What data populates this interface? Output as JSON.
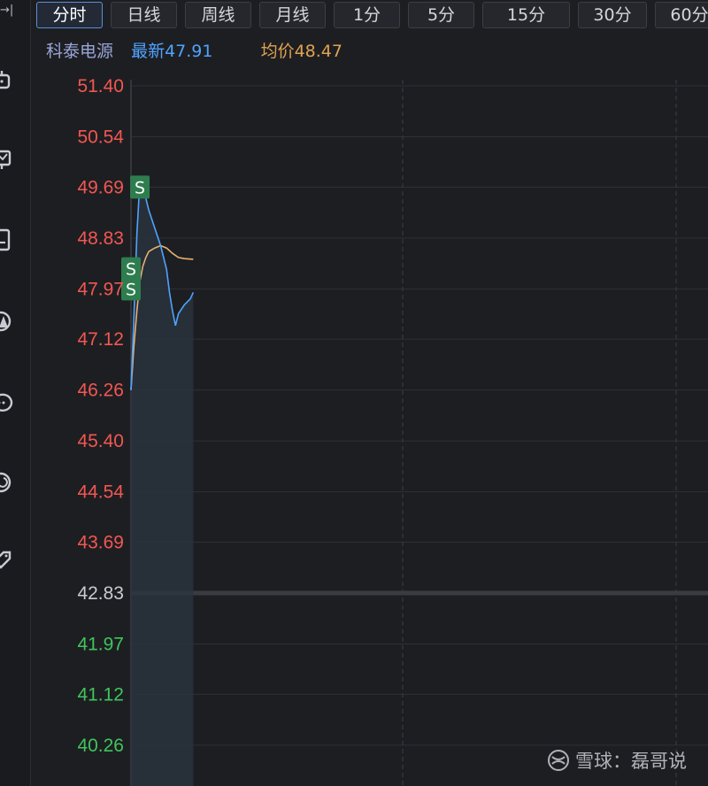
{
  "toolbar": {
    "expand_glyph": "→|",
    "tabs": [
      {
        "label": "分时",
        "active": true
      },
      {
        "label": "日线",
        "active": false
      },
      {
        "label": "周线",
        "active": false
      },
      {
        "label": "月线",
        "active": false
      },
      {
        "label": "1分",
        "active": false
      },
      {
        "label": "5分",
        "active": false
      },
      {
        "label": "15分",
        "active": false
      },
      {
        "label": "30分",
        "active": false
      },
      {
        "label": "60分",
        "active": false
      }
    ]
  },
  "legend": {
    "stock_name": "科泰电源",
    "latest_label": "最新",
    "latest_value": "47.91",
    "avg_label": "均价",
    "avg_value": "48.47"
  },
  "sidebar_icons": [
    "robot-icon",
    "monitor-chart-icon",
    "document-icon",
    "user-alert-icon",
    "chat-icon",
    "refresh-icon",
    "tag-icon"
  ],
  "colors": {
    "background": "#1d1e22",
    "up": "#f25751",
    "down": "#3fc55c",
    "neutral": "#c8cbd2",
    "price_line": "#4fa3ff",
    "avg_line": "#e8b070",
    "sell_marker": "#2e7d4f"
  },
  "chart_data": {
    "type": "line",
    "title": "",
    "ylim": [
      39.4,
      51.4
    ],
    "prev_close": 42.83,
    "yticks": [
      "51.40",
      "50.54",
      "49.69",
      "48.83",
      "47.97",
      "47.12",
      "46.26",
      "45.40",
      "44.54",
      "43.69",
      "42.83",
      "41.97",
      "41.12",
      "40.26"
    ],
    "x_range": [
      0,
      240
    ],
    "grid": true,
    "series": [
      {
        "name": "最新",
        "values": [
          [
            0,
            46.26
          ],
          [
            1,
            47.5
          ],
          [
            2,
            48.9
          ],
          [
            3,
            49.8
          ],
          [
            4,
            49.75
          ],
          [
            5,
            49.5
          ],
          [
            6,
            49.3
          ],
          [
            8,
            49.0
          ],
          [
            10,
            48.7
          ],
          [
            12,
            48.3
          ],
          [
            13,
            47.9
          ],
          [
            14,
            47.6
          ],
          [
            15,
            47.35
          ],
          [
            16,
            47.55
          ],
          [
            18,
            47.7
          ],
          [
            20,
            47.8
          ],
          [
            21,
            47.91
          ]
        ]
      },
      {
        "name": "均价",
        "values": [
          [
            0,
            46.26
          ],
          [
            1,
            47.0
          ],
          [
            2,
            47.6
          ],
          [
            3,
            48.1
          ],
          [
            4,
            48.35
          ],
          [
            5,
            48.5
          ],
          [
            6,
            48.6
          ],
          [
            8,
            48.66
          ],
          [
            10,
            48.7
          ],
          [
            12,
            48.66
          ],
          [
            14,
            48.57
          ],
          [
            16,
            48.5
          ],
          [
            18,
            48.48
          ],
          [
            21,
            48.47
          ]
        ]
      }
    ],
    "markers": [
      {
        "label": "S",
        "x": 3,
        "y": 49.69
      },
      {
        "label": "S",
        "x": 0,
        "y": 48.31
      },
      {
        "label": "S",
        "x": 0,
        "y": 47.97
      }
    ]
  },
  "watermark": {
    "text": "雪球：磊哥说"
  }
}
